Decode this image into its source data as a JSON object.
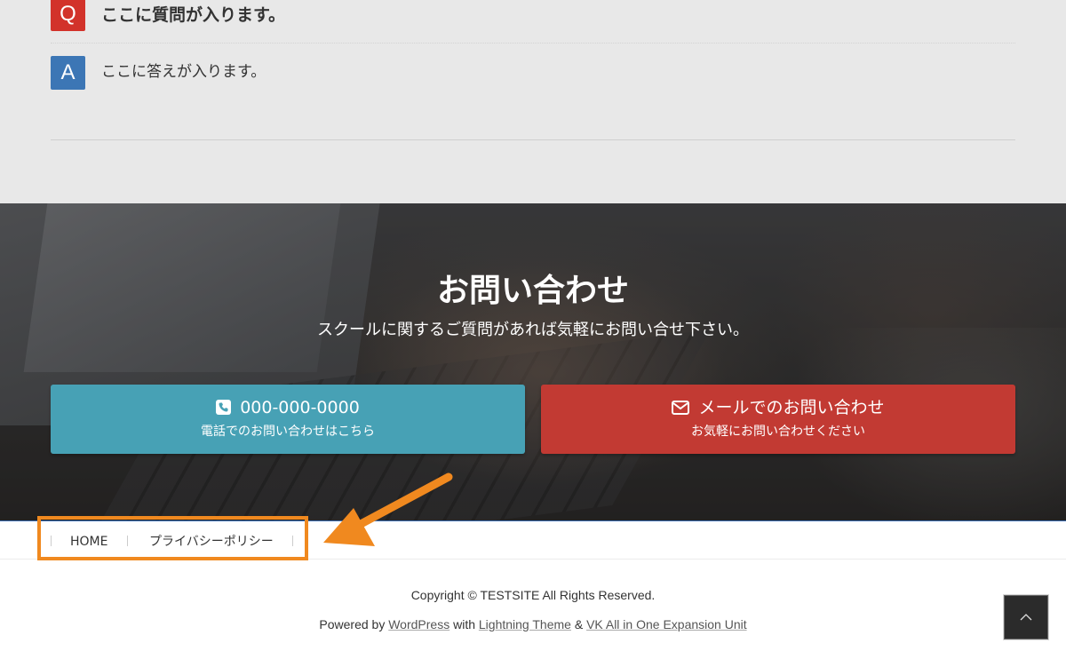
{
  "faq": {
    "q_badge": "Q",
    "question": "ここに質問が入ります。",
    "a_badge": "A",
    "answer": "ここに答えが入ります。"
  },
  "contact": {
    "title": "お問い合わせ",
    "subtitle": "スクールに関するご質問があれば気軽にお問い合せ下さい。",
    "phone_number": "000-000-0000",
    "phone_note": "電話でのお問い合わせはこちら",
    "mail_label": "メールでのお問い合わせ",
    "mail_note": "お気軽にお問い合わせください"
  },
  "footer_nav": {
    "items": [
      "HOME",
      "プライバシーポリシー"
    ]
  },
  "footer": {
    "copyright": "Copyright © TESTSITE All Rights Reserved.",
    "powered_prefix": "Powered by",
    "wordpress": "WordPress",
    "with": "with",
    "theme": "Lightning Theme",
    "amp": "&",
    "plugin": "VK All in One Expansion Unit"
  },
  "colors": {
    "q_badge": "#d2322a",
    "a_badge": "#3c76b5",
    "phone_button": "#47a1b5",
    "mail_button": "#c23a33",
    "annotation": "#f0891f"
  },
  "icons": {
    "phone": "phone-square-icon",
    "mail": "envelope-icon",
    "to_top": "chevron-up-icon"
  }
}
